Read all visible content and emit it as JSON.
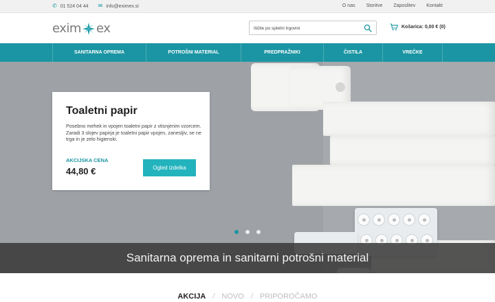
{
  "topbar": {
    "phone": "01 524 04 44",
    "email": "info@eximex.si",
    "links": [
      "O nas",
      "Storitve",
      "Zaposlitev",
      "Kontakt"
    ]
  },
  "header": {
    "logo_left": "exim",
    "logo_right": "ex",
    "search_placeholder": "Iščite po spletni trgovini",
    "cart_label": "Košarica: 0,00 € (0)"
  },
  "nav": {
    "items": [
      "SANITARNA OPREMA",
      "POTROŠNI MATERIAL",
      "PREDPRAŽNIKI",
      "ČISTILA",
      "VREČKE"
    ]
  },
  "hero": {
    "title": "Toaletni papir",
    "description": "Posebno mehek in vpojen toaletni papir z vtisnjenim vzorcem. Zaradi 3 slojev papirja je toaletni papir vpojen, zanesljiv, se ne trga in je zelo higienski.",
    "price_label": "AKCIJSKA CENA",
    "price": "44,80 €",
    "button": "Ogled izdelka",
    "caption": "Sanitarna oprema in sanitarni potrošni material",
    "slides": 3,
    "active_slide": 1
  },
  "tabs": {
    "items": [
      "AKCIJA",
      "NOVO",
      "PRIPOROČAMO"
    ],
    "active": "AKCIJA",
    "separator": "/"
  },
  "colors": {
    "accent": "#1b95a3",
    "button": "#23b3bd"
  }
}
